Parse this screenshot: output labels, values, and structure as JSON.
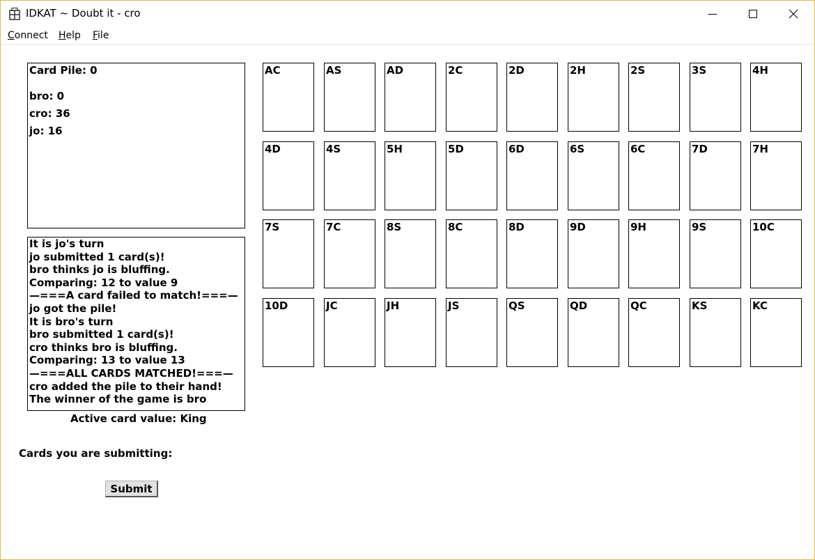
{
  "window": {
    "title": "IDKAT ~ Doubt it - cro"
  },
  "menu": [
    {
      "key": "C",
      "rest": "onnect"
    },
    {
      "key": "H",
      "rest": "elp"
    },
    {
      "key": "F",
      "rest": "ile"
    }
  ],
  "scores": {
    "card_pile": "Card Pile: 0",
    "players": [
      "bro: 0",
      "cro: 36",
      "jo: 16"
    ]
  },
  "log": [
    "It is jo's turn",
    "jo submitted 1 card(s)!",
    "bro thinks jo is bluffing.",
    "Comparing: 12 to value 9",
    "—===A card failed to match!===—",
    "jo got the pile!",
    "It is bro's turn",
    "bro submitted 1 card(s)!",
    "cro thinks bro is bluffing.",
    "Comparing: 13 to value 13",
    "—===ALL CARDS MATCHED!===—",
    "cro added the pile to their hand!",
    "The winner of the game is bro"
  ],
  "active_card_value": "Active card value: King",
  "submitting_label": "Cards you are submitting:",
  "submit_label": "Submit",
  "cards": [
    [
      "AC",
      "AS",
      "AD",
      "2C",
      "2D",
      "2H",
      "2S",
      "3S",
      "4H"
    ],
    [
      "4D",
      "4S",
      "5H",
      "5D",
      "6D",
      "6S",
      "6C",
      "7D",
      "7H"
    ],
    [
      "7S",
      "7C",
      "8S",
      "8C",
      "8D",
      "9D",
      "9H",
      "9S",
      "10C"
    ],
    [
      "10D",
      "JC",
      "JH",
      "JS",
      "QS",
      "QD",
      "QC",
      "KS",
      "KC"
    ]
  ],
  "colors": {
    "window_border": "#e6b94a",
    "background": "#ffffff",
    "text": "#000000"
  },
  "icons": {
    "app": "app-icon",
    "minimize": "minimize-icon",
    "maximize": "maximize-icon",
    "close": "close-icon"
  }
}
